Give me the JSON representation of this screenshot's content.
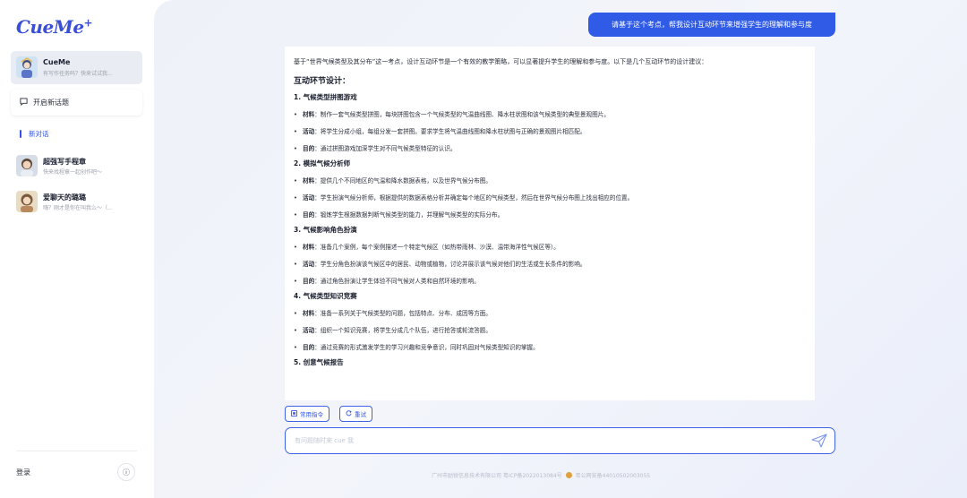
{
  "app": {
    "logo": "CueMe",
    "logo_mark": "+"
  },
  "sidebar": {
    "active_chat": {
      "title": "CueMe",
      "subtitle": "有写作任务吗？快来试试我..."
    },
    "new_topic_label": "开启新话题",
    "new_chat_label": "新对话",
    "chats": [
      {
        "title": "超强写手程章",
        "subtitle": "快来找程章一起创作吧～"
      },
      {
        "title": "爱聊天的璐璐",
        "subtitle": "嗨？刚才是你在叫我么～（..."
      }
    ],
    "login_label": "登录",
    "info_glyph": "ⓘ"
  },
  "conversation": {
    "user_message": "请基于这个考点，帮我设计互动环节来增强学生的理解和参与度",
    "intro": "基于“世界气候类型及其分布”这一考点，设计互动环节是一个有效的教学策略，可以显著提升学生的理解和参与度。以下是几个互动环节的设计建议：",
    "section_title": "互动环节设计：",
    "items": [
      {
        "title": "1. 气候类型拼图游戏",
        "bullets": [
          {
            "label": "材料",
            "text": "：制作一套气候类型拼图，每块拼图包含一个气候类型的气温曲线图、降水柱状图和该气候类型的典型景观图片。"
          },
          {
            "label": "活动",
            "text": "：将学生分成小组，每组分发一套拼图。要求学生将气温曲线图和降水柱状图与正确的景观图片相匹配。"
          },
          {
            "label": "目的",
            "text": "：通过拼图游戏加深学生对不同气候类型特征的认识。"
          }
        ]
      },
      {
        "title": "2. 模拟气候分析师",
        "bullets": [
          {
            "label": "材料",
            "text": "：提供几个不同地区的气温和降水数据表格，以及世界气候分布图。"
          },
          {
            "label": "活动",
            "text": "：学生扮演气候分析师，根据提供的数据表格分析并确定每个地区的气候类型，然后在世界气候分布图上找出相应的位置。"
          },
          {
            "label": "目的",
            "text": "：锻炼学生根据数据判断气候类型的能力，并理解气候类型的实际分布。"
          }
        ]
      },
      {
        "title": "3. 气候影响角色扮演",
        "bullets": [
          {
            "label": "材料",
            "text": "：准备几个案例，每个案例描述一个特定气候区（如热带雨林、沙漠、温带海洋性气候区等）。"
          },
          {
            "label": "活动",
            "text": "：学生分角色扮演该气候区中的居民、动物或植物，讨论并展示该气候对他们的生活或生长条件的影响。"
          },
          {
            "label": "目的",
            "text": "：通过角色扮演让学生体验不同气候对人类和自然环境的影响。"
          }
        ]
      },
      {
        "title": "4. 气候类型知识竞赛",
        "bullets": [
          {
            "label": "材料",
            "text": "：准备一系列关于气候类型的问题，包括特点、分布、成因等方面。"
          },
          {
            "label": "活动",
            "text": "：组织一个知识竞赛，将学生分成几个队伍，进行抢答或轮流答题。"
          },
          {
            "label": "目的",
            "text": "：通过竞赛的形式激发学生的学习兴趣和竞争意识，同时巩固对气候类型知识的掌握。"
          }
        ]
      },
      {
        "title": "5. 创意气候报告",
        "bullets": []
      }
    ]
  },
  "actions": {
    "common_commands_label": "常用指令",
    "retry_label": "重试"
  },
  "input": {
    "placeholder": "有问题随时来 cue 我",
    "value": ""
  },
  "footer": {
    "company": "广州市励锐信息技术有限公司 粤ICP备2022013084号",
    "police": "粤公网安备44010502003055"
  },
  "colors": {
    "accent": "#2f54eb",
    "user_bubble": "#2f5be7"
  }
}
